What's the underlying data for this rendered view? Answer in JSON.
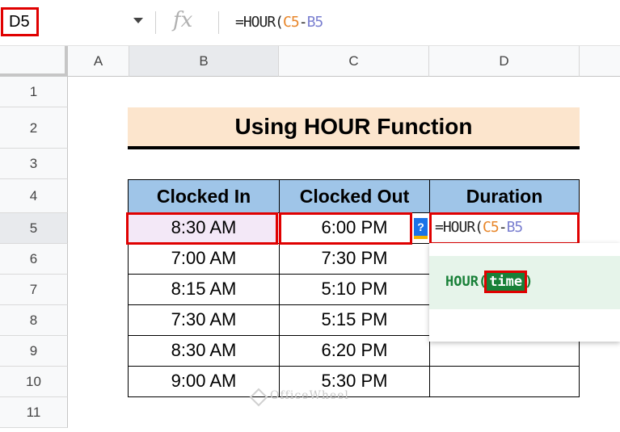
{
  "formula_bar": {
    "name_box": "D5",
    "fx_icon": "fx",
    "formula_prefix": "=HOUR(",
    "formula_ref1": "C5",
    "formula_op": "-",
    "formula_ref2": "B5"
  },
  "columns": [
    "A",
    "B",
    "C",
    "D"
  ],
  "rows": [
    "1",
    "2",
    "3",
    "4",
    "5",
    "6",
    "7",
    "8",
    "9",
    "10",
    "11"
  ],
  "title": "Using HOUR Function",
  "table": {
    "headers": [
      "Clocked In",
      "Clocked Out",
      "Duration"
    ],
    "rows": [
      [
        "8:30 AM",
        "6:00 PM"
      ],
      [
        "7:00 AM",
        "7:30 PM"
      ],
      [
        "8:15 AM",
        "5:10 PM"
      ],
      [
        "7:30 AM",
        "5:15 PM"
      ],
      [
        "8:30 AM",
        "6:20 PM"
      ],
      [
        "9:00 AM",
        "5:30 PM"
      ]
    ]
  },
  "edit_cell": {
    "prefix": "=HOUR(",
    "ref1": "C5",
    "op": "-",
    "ref2": "B5"
  },
  "help_button": "?",
  "tooltip": {
    "fn_open": "HOUR(",
    "arg": "time",
    "fn_close": ")"
  },
  "watermark": "OfficeWheel",
  "colors": {
    "highlight": "#e00000",
    "header_fill": "#9fc5e8",
    "title_fill": "#fce5cd",
    "tooltip_green": "#188038"
  }
}
